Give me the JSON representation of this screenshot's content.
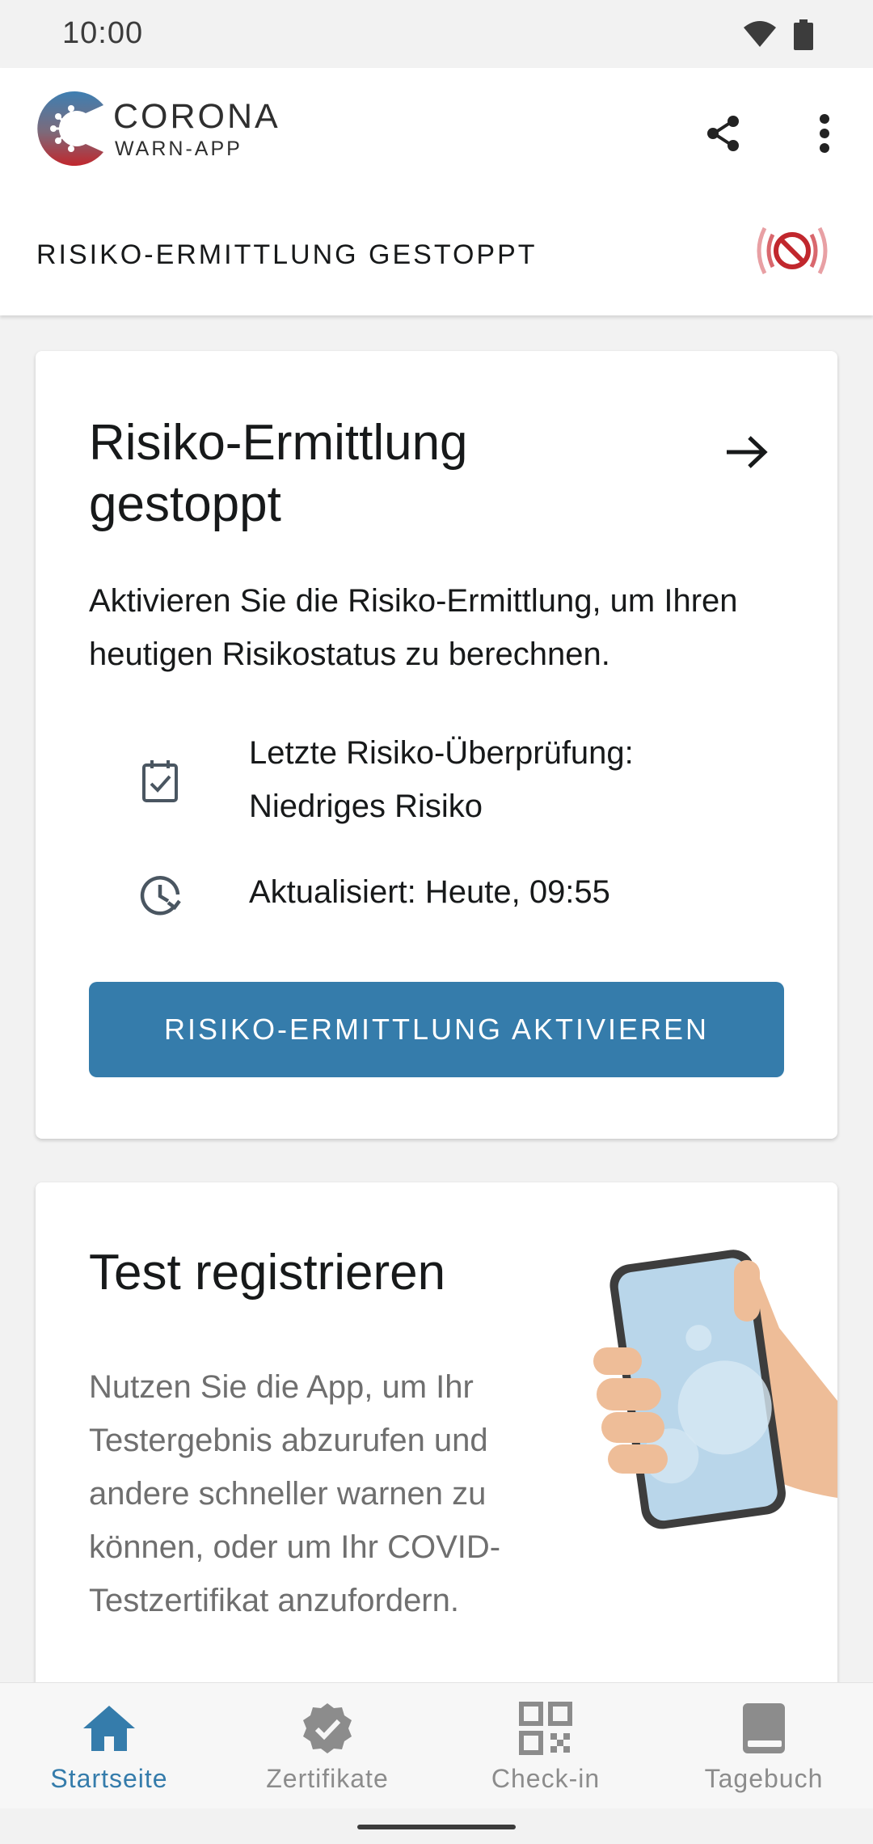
{
  "status_bar": {
    "time": "10:00"
  },
  "header": {
    "brand_title": "CORONA",
    "brand_subtitle": "WARN-APP",
    "risk_status": "RISIKO-ERMITTLUNG GESTOPPT"
  },
  "risk_card": {
    "title": "Risiko-Ermittlung gestoppt",
    "body": "Aktivieren Sie die Risiko-Ermittlung, um Ihren heutigen Risikostatus zu berechnen.",
    "last_check_label": "Letzte Risiko-Überprüfung:",
    "last_check_value": "Niedriges Risiko",
    "updated": "Aktualisiert: Heute, 09:55",
    "button": "RISIKO-ERMITTLUNG AKTIVIEREN"
  },
  "test_card": {
    "title": "Test registrieren",
    "body": "Nutzen Sie die App, um Ihr Testergebnis abzurufen und andere schneller warnen zu können, oder um Ihr COVID-Testzertifikat anzufordern."
  },
  "bottom_nav": {
    "items": [
      {
        "label": "Startseite",
        "icon": "home-icon",
        "active": true
      },
      {
        "label": "Zertifikate",
        "icon": "certificate-icon",
        "active": false
      },
      {
        "label": "Check-in",
        "icon": "qr-code-icon",
        "active": false
      },
      {
        "label": "Tagebuch",
        "icon": "book-icon",
        "active": false
      }
    ]
  },
  "colors": {
    "accent": "#357cab",
    "stopped_red": "#c1272d",
    "text": "#17191a",
    "muted": "#6f6f6f"
  }
}
